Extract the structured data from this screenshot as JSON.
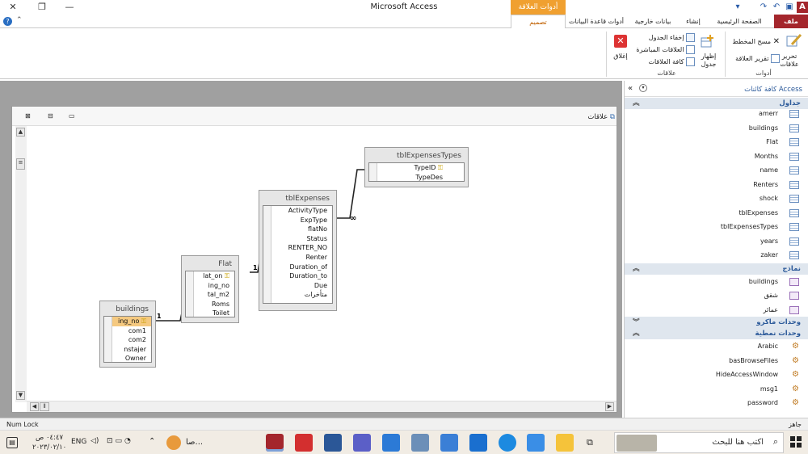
{
  "window": {
    "title": "Microsoft Access",
    "context_group": "أدوات العلاقة"
  },
  "tabs": {
    "file": "ملف",
    "home": "الصفحة الرئيسية",
    "create": "إنشاء",
    "external": "بيانات خارجية",
    "dbtools": "أدوات قاعدة البيانات",
    "design": "تصميم"
  },
  "ribbon": {
    "edit_rel_1": "تحرير",
    "edit_rel_2": "علاقات",
    "clear_layout": "مسح المخطط",
    "rel_report": "تقرير العلاقة",
    "tools_label": "أدوات",
    "show_table_1": "إظهار",
    "show_table_2": "جدول",
    "hide_table": "إخفاء الجدول",
    "direct_rels": "العلاقات المباشرة",
    "all_rels": "كافة العلاقات",
    "rels_label": "علاقات",
    "close": "إغلاق"
  },
  "relwin": {
    "tab_label": "علاقات"
  },
  "tables": {
    "buildings": {
      "title": "buildings",
      "fields": [
        "ing_no",
        "com1",
        "com2",
        "nstajer",
        "Owner"
      ]
    },
    "flat": {
      "title": "Flat",
      "fields": [
        "lat_on",
        "ing_no",
        "tal_m2",
        "Roms",
        "Toilet"
      ]
    },
    "tblexpenses": {
      "title": "tblExpenses",
      "fields": [
        "ActivityType",
        "ExpType",
        "flatNo",
        "Status",
        "RENTER_NO",
        "Renter",
        "Duration_of",
        "Duration_to",
        "Due",
        "متأخرات"
      ]
    },
    "tbltypes": {
      "title": "tblExpensesTypes",
      "fields": [
        "TypeID",
        "TypeDes"
      ]
    }
  },
  "relations": {
    "one": "1",
    "many": "∞"
  },
  "nav": {
    "title": "كافة كائنات Access",
    "tables_header": "جداول",
    "tables": [
      "amerr",
      "buildings",
      "Flat",
      "Months",
      "name",
      "Renters",
      "shock",
      "tblExpenses",
      "tblExpensesTypes",
      "years",
      "zaker"
    ],
    "forms_header": "نماذج",
    "forms": [
      "buildings",
      "شقق",
      "عمائر"
    ],
    "macros_header": "وحدات ماكرو",
    "modules_header": "وحدات نمطية",
    "modules": [
      "Arabic",
      "basBrowseFiles",
      "HideAccessWindow",
      "msg1",
      "password"
    ]
  },
  "status": {
    "left": "Num Lock",
    "right": "جاهز"
  },
  "taskbar": {
    "search": "اكتب هنا للبحث",
    "lang": "ENG",
    "time": "٠٤:٤٧ ص",
    "date": "٢٠٢٣/٠٢/١٠",
    "weather": "صا..."
  },
  "colors": {
    "file_tab": "#a4262c",
    "context": "#f0a030",
    "nav_header": "#2c5a9a"
  }
}
